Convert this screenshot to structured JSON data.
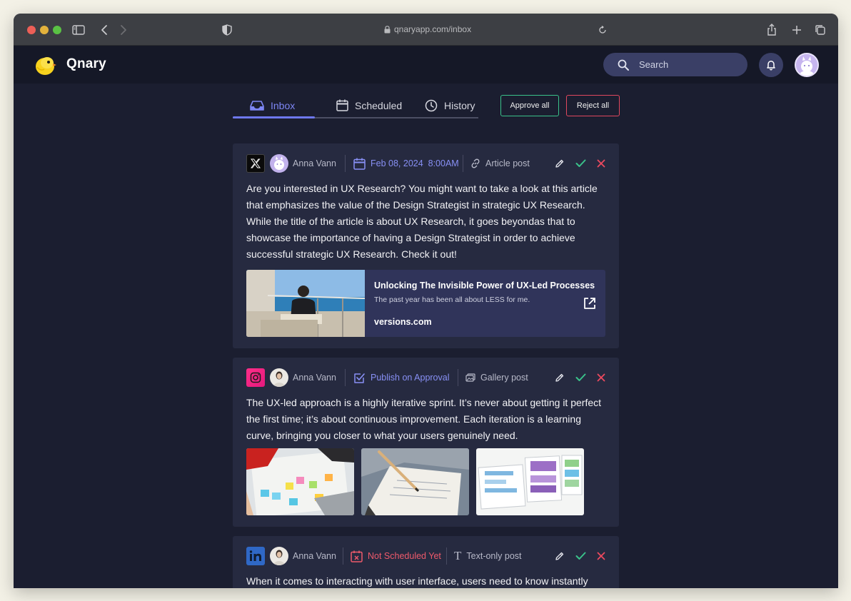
{
  "browser": {
    "url": "qnaryapp.com/inbox"
  },
  "app": {
    "brand": "Qnary",
    "search_placeholder": "Search"
  },
  "tabs": [
    {
      "label": "Inbox",
      "active": true
    },
    {
      "label": "Scheduled",
      "active": false
    },
    {
      "label": "History",
      "active": false
    }
  ],
  "bulk_actions": {
    "approve_all": "Approve all",
    "reject_all": "Reject all"
  },
  "posts": [
    {
      "network": "x",
      "author": "Anna Vann",
      "schedule": "Feb 08, 2024  8:00AM",
      "schedule_color": "#8890f5",
      "post_type": "Article post",
      "text": "Are you interested in UX Research? You might want to take a look at this article that emphasizes the value of the Design Strategist in strategic UX Research. While the title of the article is about UX Research, it goes beyondas that to showcase the importance of having a Design Strategist in order to achieve successful strategic UX Research. Check it out!",
      "link": {
        "title": "Unlocking The Invisible Power of UX-Led Processes",
        "subtitle": "The past year has been all about LESS for me.",
        "domain": "versions.com"
      }
    },
    {
      "network": "instagram",
      "author": "Anna Vann",
      "schedule": "Publish on Approval",
      "schedule_color": "#8890f5",
      "post_type": "Gallery post",
      "text": "The UX-led approach is a highly iterative sprint. It’s never about getting it perfect the first time; it’s about continuous improvement. Each iteration is a learning curve, bringing you closer to what your users genuinely need."
    },
    {
      "network": "linkedin",
      "author": "Anna Vann",
      "schedule": "Not Scheduled Yet",
      "schedule_color": "#ee5a6b",
      "post_type": "Text-only post",
      "text": "When it comes to interacting with user interface, users need to know instantly what is ‘clickable’ and what’s not. Every item in a design requires effort by the"
    }
  ],
  "colors": {
    "accent": "#6e78ee",
    "approve": "#3ac28a",
    "reject": "#e0485e",
    "background": "#1b1e30",
    "card": "#262a40"
  }
}
